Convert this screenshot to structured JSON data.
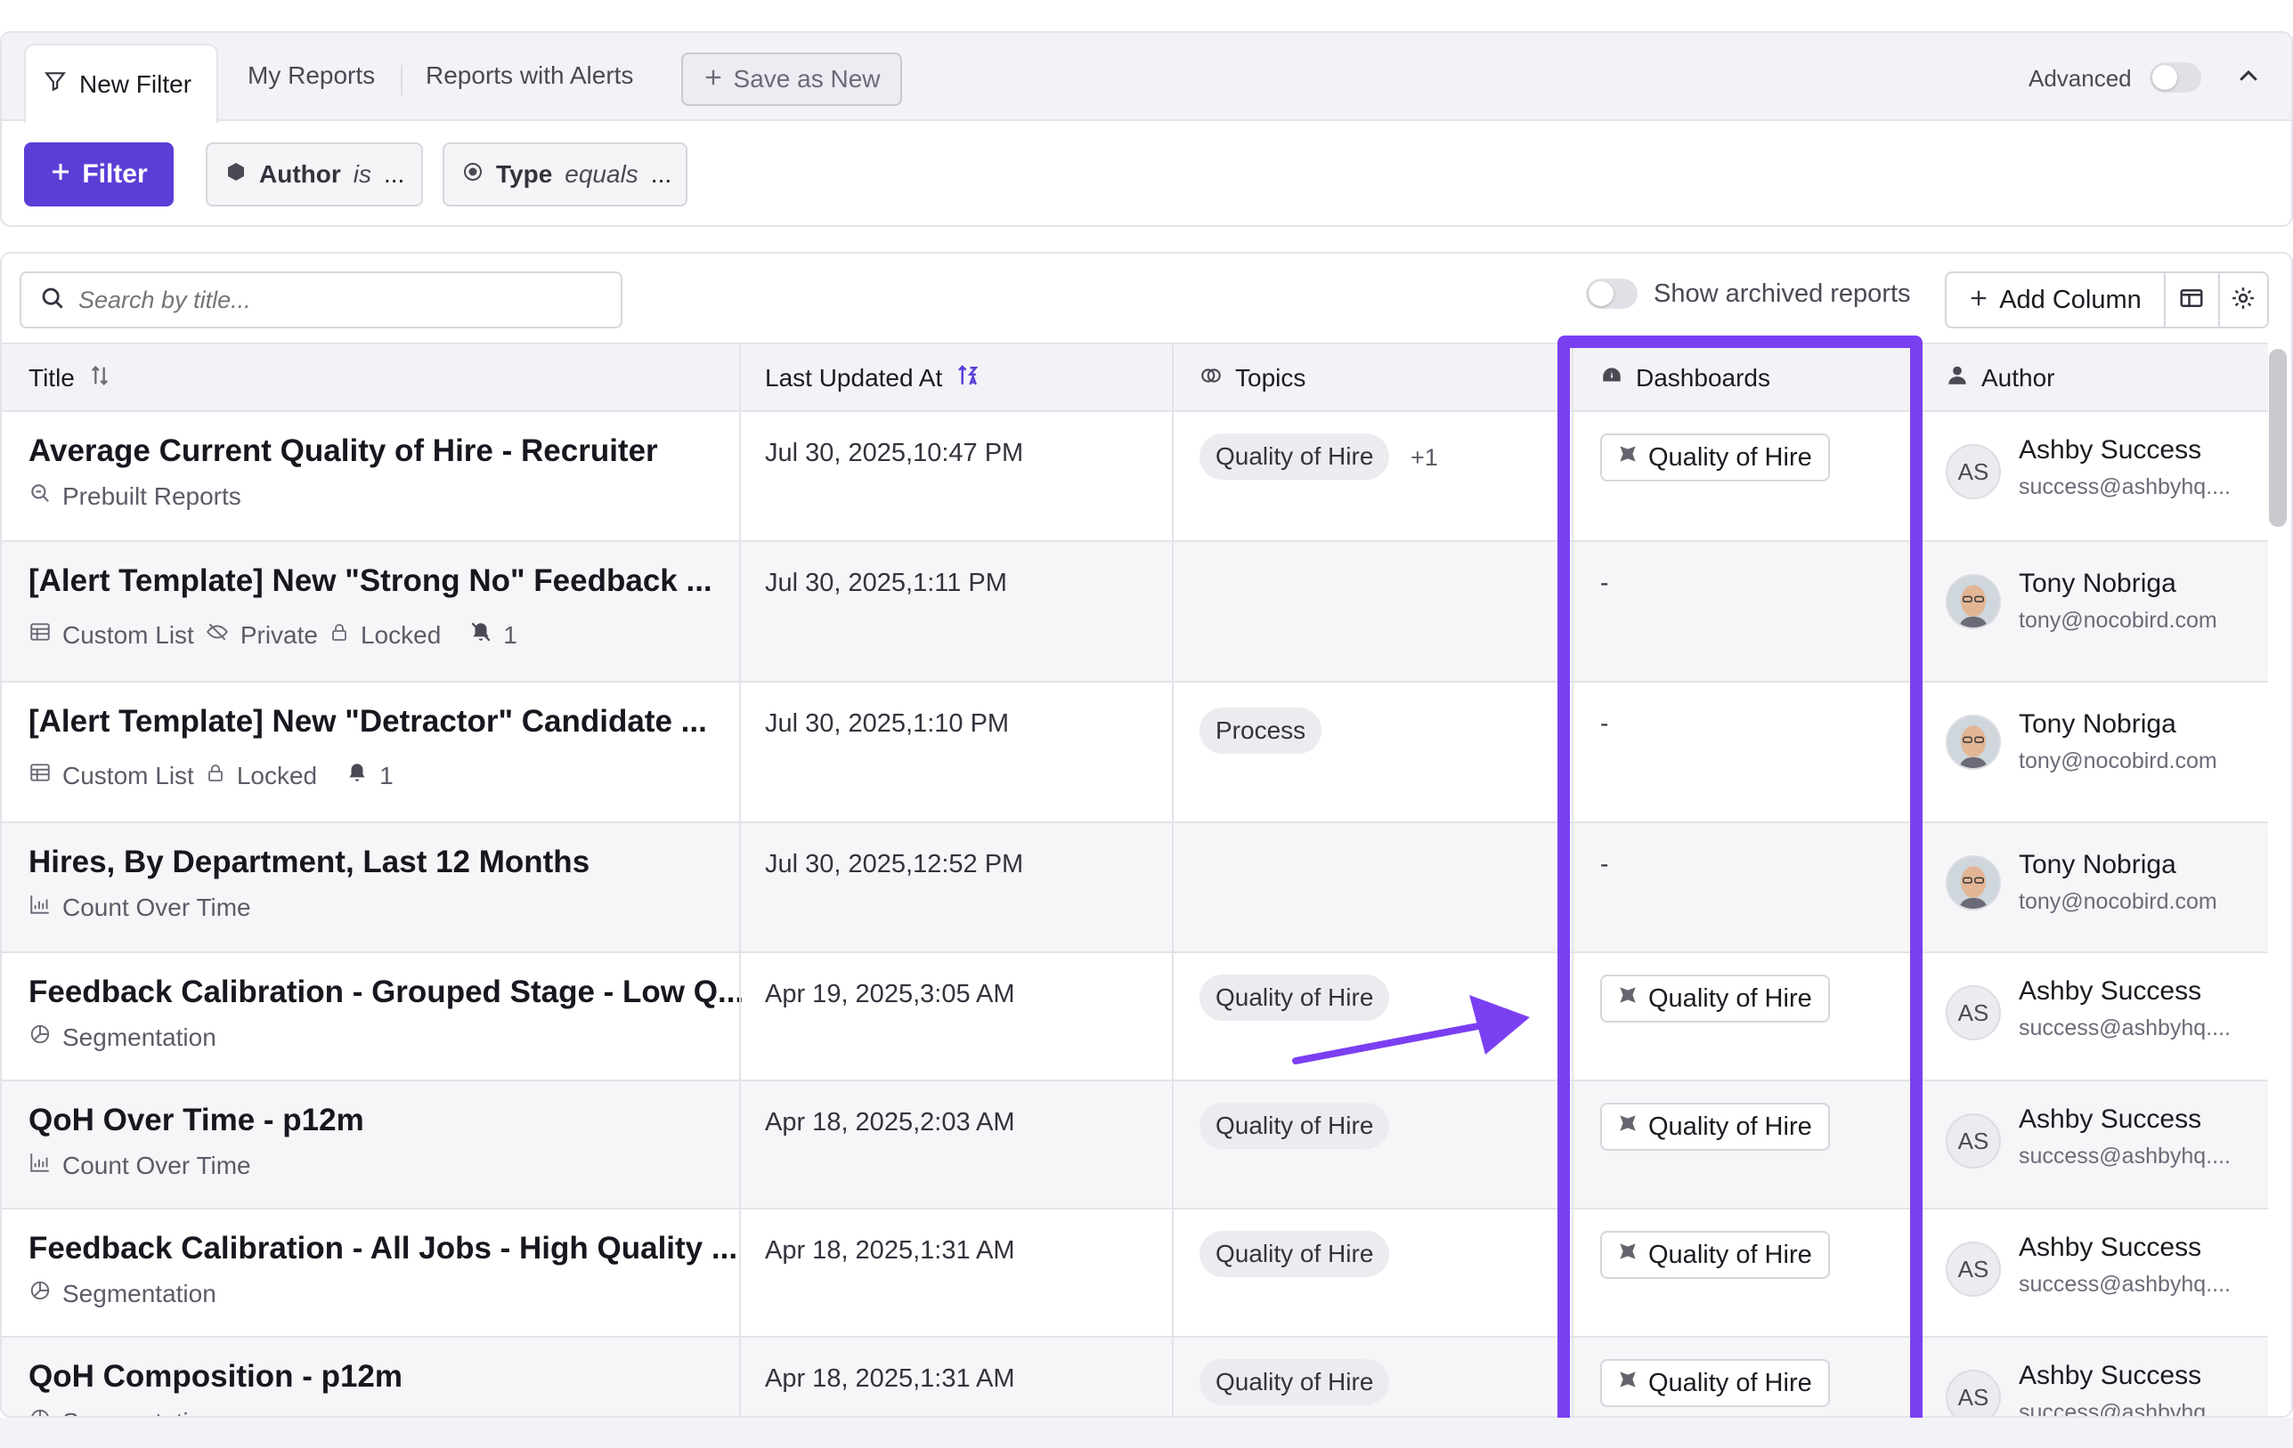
{
  "tabs": {
    "new_filter": "New Filter",
    "my_reports": "My Reports",
    "reports_with_alerts": "Reports with Alerts",
    "save_as_new": "Save as New",
    "advanced": "Advanced"
  },
  "filters": {
    "filter_button": "Filter",
    "author_field": "Author",
    "author_op": "is",
    "author_value": "...",
    "type_field": "Type",
    "type_op": "equals",
    "type_value": "..."
  },
  "toolbar": {
    "search_placeholder": "Search by title...",
    "show_archived": "Show archived reports",
    "add_column": "Add Column"
  },
  "columns": {
    "title": "Title",
    "last_updated": "Last Updated At",
    "topics": "Topics",
    "dashboards": "Dashboards",
    "author": "Author"
  },
  "rows": [
    {
      "title": "Average Current Quality of Hire - Recruiter",
      "meta": [
        "Prebuilt Reports"
      ],
      "date": "Jul 30, 2025,",
      "time": "10:47 PM",
      "topic": "Quality of Hire",
      "topic_more": "+1",
      "dashboard": "Quality of Hire",
      "author_name": "Ashby Success",
      "author_email": "success@ashbyhq....",
      "initials": "AS"
    },
    {
      "title": "[Alert Template] New \"Strong No\" Feedback ...",
      "meta": [
        "Custom List",
        "Private",
        "Locked"
      ],
      "alert_count": "1",
      "date": "Jul 30, 2025,",
      "time": "1:11 PM",
      "dashboard_none": "-",
      "author_name": "Tony Nobriga",
      "author_email": "tony@nocobird.com"
    },
    {
      "title": "[Alert Template] New \"Detractor\" Candidate ...",
      "meta": [
        "Custom List",
        "Locked"
      ],
      "alert_count": "1",
      "date": "Jul 30, 2025,",
      "time": "1:10 PM",
      "topic": "Process",
      "dashboard_none": "-",
      "author_name": "Tony Nobriga",
      "author_email": "tony@nocobird.com"
    },
    {
      "title": "Hires, By Department, Last 12 Months",
      "meta": [
        "Count Over Time"
      ],
      "date": "Jul 30, 2025,",
      "time": "12:52 PM",
      "dashboard_none": "-",
      "author_name": "Tony Nobriga",
      "author_email": "tony@nocobird.com"
    },
    {
      "title": "Feedback Calibration - Grouped Stage - Low Q...",
      "meta": [
        "Segmentation"
      ],
      "date": "Apr 19, 2025,",
      "time": "3:05 AM",
      "topic": "Quality of Hire",
      "dashboard": "Quality of Hire",
      "author_name": "Ashby Success",
      "author_email": "success@ashbyhq....",
      "initials": "AS"
    },
    {
      "title": "QoH Over Time - p12m",
      "meta": [
        "Count Over Time"
      ],
      "date": "Apr 18, 2025,",
      "time": "2:03 AM",
      "topic": "Quality of Hire",
      "dashboard": "Quality of Hire",
      "author_name": "Ashby Success",
      "author_email": "success@ashbyhq....",
      "initials": "AS"
    },
    {
      "title": "Feedback Calibration - All Jobs - High Quality ...",
      "meta": [
        "Segmentation"
      ],
      "date": "Apr 18, 2025,",
      "time": "1:31 AM",
      "topic": "Quality of Hire",
      "dashboard": "Quality of Hire",
      "author_name": "Ashby Success",
      "author_email": "success@ashbyhq....",
      "initials": "AS"
    },
    {
      "title": "QoH Composition - p12m",
      "meta": [
        "Segmentation"
      ],
      "date": "Apr 18, 2025,",
      "time": "1:31 AM",
      "topic": "Quality of Hire",
      "dashboard": "Quality of Hire",
      "author_name": "Ashby Success",
      "author_email": "success@ashbyhq....",
      "initials": "AS"
    }
  ],
  "colors": {
    "accent": "#5b3ed6",
    "highlight": "#7b3ff2"
  }
}
